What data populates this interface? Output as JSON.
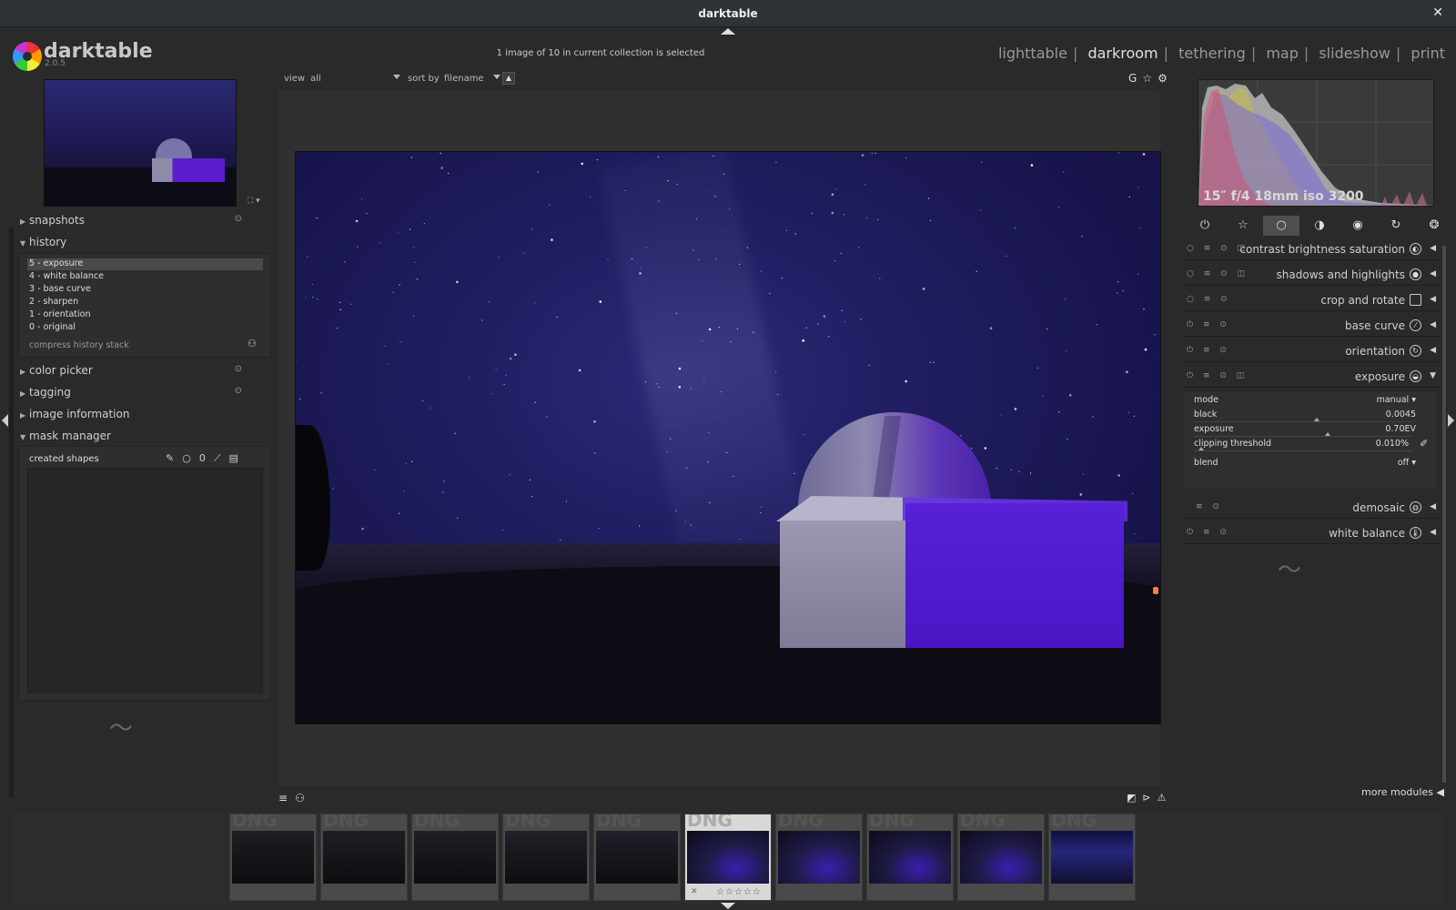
{
  "window": {
    "title": "darktable",
    "close": "✕"
  },
  "logo": {
    "name": "darktable",
    "version": "2.0.5"
  },
  "header": {
    "collection_status": "1 image of 10 in current collection is selected",
    "views": [
      {
        "label": "lighttable",
        "active": false
      },
      {
        "label": "darkroom",
        "active": true
      },
      {
        "label": "tethering",
        "active": false
      },
      {
        "label": "map",
        "active": false
      },
      {
        "label": "slideshow",
        "active": false
      },
      {
        "label": "print",
        "active": false
      }
    ]
  },
  "left": {
    "snapshots": "snapshots",
    "history": {
      "title": "history",
      "items": [
        "5 - exposure",
        "4 - white balance",
        "3 - base curve",
        "2 - sharpen",
        "1 - orientation",
        "0 - original"
      ],
      "selected_index": 0,
      "compress_label": "compress history stack"
    },
    "color_picker": "color picker",
    "tagging": "tagging",
    "image_information": "image information",
    "mask_manager": {
      "title": "mask manager",
      "list_title": "created shapes"
    }
  },
  "center": {
    "view_label": "view",
    "view_value": "all",
    "sort_label": "sort by",
    "sort_value": "filename",
    "grouping": "G"
  },
  "right": {
    "exif": "15″ f/4 18mm iso 3200",
    "modules": [
      {
        "name": "contrast brightness saturation"
      },
      {
        "name": "shadows and highlights"
      },
      {
        "name": "crop and rotate"
      },
      {
        "name": "base curve"
      },
      {
        "name": "orientation"
      },
      {
        "name": "exposure"
      },
      {
        "name": "demosaic"
      },
      {
        "name": "white balance"
      }
    ],
    "exposure_params": {
      "mode_label": "mode",
      "mode_value": "manual",
      "black_label": "black",
      "black_value": "0.0045",
      "black_level": 0.55,
      "exposure_label": "exposure",
      "exposure_value": "0.70EV",
      "exposure_level": 0.6,
      "clipping_label": "clipping threshold",
      "clipping_value": "0.010%",
      "clipping_level": 0.02,
      "blend_label": "blend",
      "blend_value": "off"
    },
    "more_modules": "more modules"
  },
  "filmstrip": {
    "count": 10,
    "current_index": 5,
    "badge": "DNG",
    "rating": "☆☆☆☆☆"
  }
}
